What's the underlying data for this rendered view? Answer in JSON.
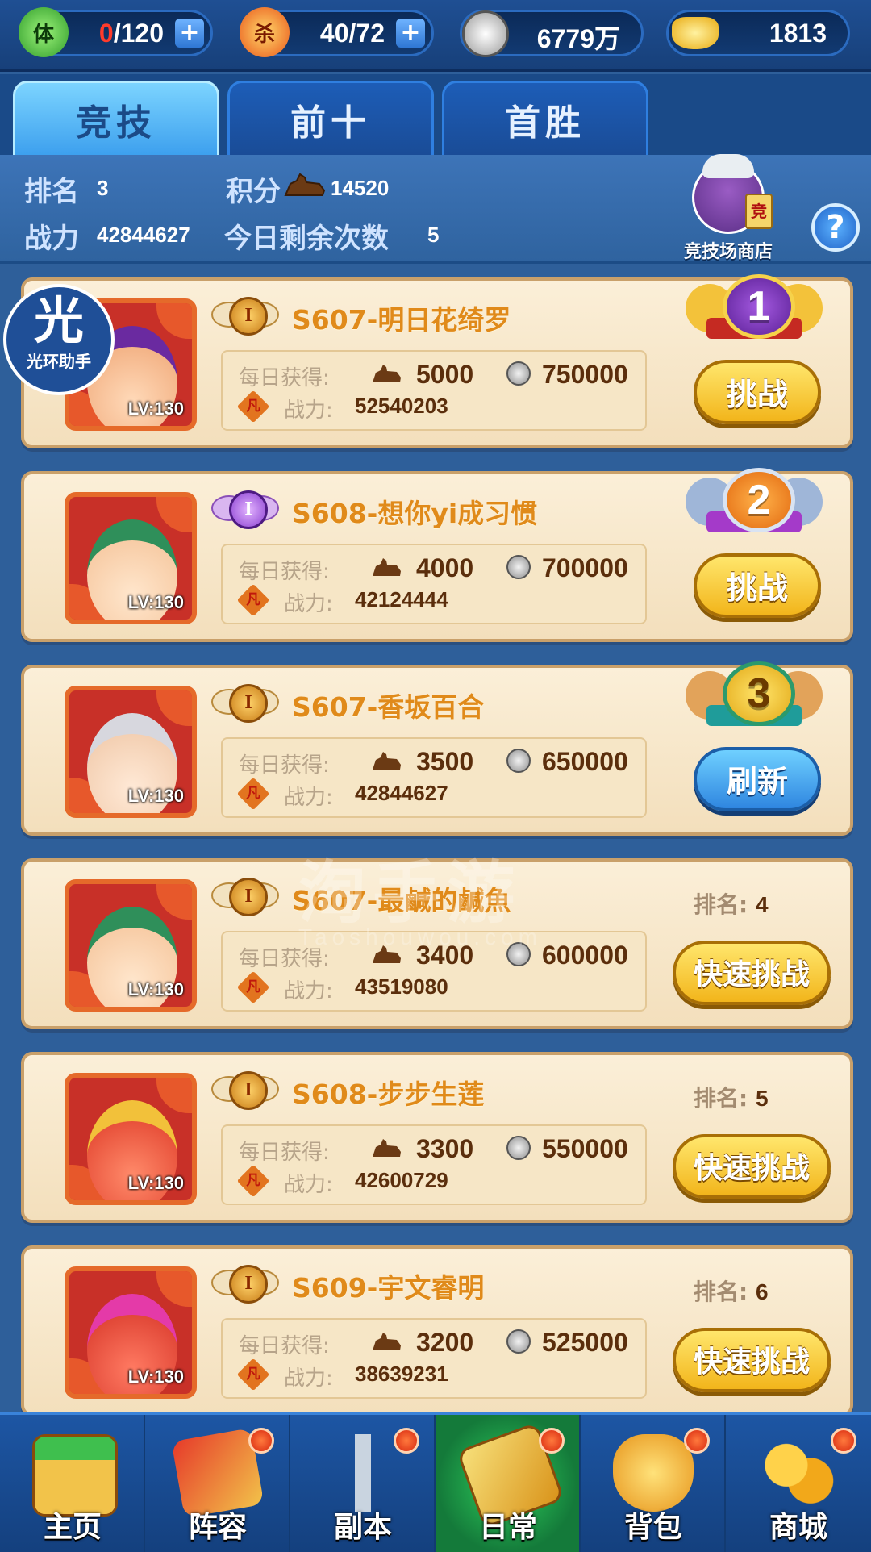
{
  "resources": {
    "stamina": {
      "icon_text": "体",
      "current": "0",
      "max": "/120",
      "icon": "stamina-leaf-icon"
    },
    "kill": {
      "icon_text": "杀",
      "value": "40/72",
      "icon": "kill-flame-icon"
    },
    "silver": {
      "value": "6779万",
      "icon": "silver-coin-icon"
    },
    "gold": {
      "value": "1813",
      "icon": "gold-ingot-icon"
    },
    "plus": "+"
  },
  "tabs": [
    {
      "label": "竞技",
      "active": true
    },
    {
      "label": "前十",
      "active": false
    },
    {
      "label": "首胜",
      "active": false
    }
  ],
  "player": {
    "rank_label": "排名",
    "rank_value": "3",
    "score_label": "积分",
    "score_value": "14520",
    "power_label": "战力",
    "power_value": "42844627",
    "remaining_label": "今日剩余次数",
    "remaining_value": "5"
  },
  "shop": {
    "label": "竞技场商店",
    "tag": "竞"
  },
  "help": "?",
  "helper": {
    "big": "光",
    "small": "光环助手"
  },
  "watermark": {
    "main": "淘手游",
    "sub": "Taoshouwou.com"
  },
  "card_labels": {
    "daily": "每日获得:",
    "power": "战力:",
    "power_icon_text": "凡",
    "rank": "排名:"
  },
  "opponents": [
    {
      "name": "S607-明日花绮罗",
      "level": "LV:130",
      "badge": "I",
      "score": "5000",
      "silver": "750000",
      "power": "52540203",
      "medal": "1",
      "action": "挑战",
      "action_style": "gold"
    },
    {
      "name": "S608-想你yi成习惯",
      "level": "LV:130",
      "badge": "I",
      "score": "4000",
      "silver": "700000",
      "power": "42124444",
      "medal": "2",
      "action": "挑战",
      "action_style": "gold"
    },
    {
      "name": "S607-香坂百合",
      "level": "LV:130",
      "badge": "I",
      "score": "3500",
      "silver": "650000",
      "power": "42844627",
      "medal": "3",
      "action": "刷新",
      "action_style": "blue"
    },
    {
      "name": "S607-最鹹的鹹魚",
      "level": "LV:130",
      "badge": "I",
      "score": "3400",
      "silver": "600000",
      "power": "43519080",
      "rank": "4",
      "action": "快速挑战",
      "action_style": "gold"
    },
    {
      "name": "S608-步步生莲",
      "level": "LV:130",
      "badge": "I",
      "score": "3300",
      "silver": "550000",
      "power": "42600729",
      "rank": "5",
      "action": "快速挑战",
      "action_style": "gold"
    },
    {
      "name": "S609-宇文睿明",
      "level": "LV:130",
      "badge": "I",
      "score": "3200",
      "silver": "525000",
      "power": "38639231",
      "rank": "6",
      "action": "快速挑战",
      "action_style": "gold"
    }
  ],
  "nav": [
    {
      "label": "主页",
      "icon": "home-palace-icon"
    },
    {
      "label": "阵容",
      "icon": "lineup-scroll-icon"
    },
    {
      "label": "副本",
      "icon": "dungeon-sword-icon"
    },
    {
      "label": "日常",
      "icon": "daily-scroll-icon",
      "active": true
    },
    {
      "label": "背包",
      "icon": "bag-icon"
    },
    {
      "label": "商城",
      "icon": "shop-coins-icon"
    }
  ],
  "colors": {
    "accent": "#2f7fe0",
    "card": "#f6e6c6",
    "gold_button": "#f2b51b",
    "blue_button": "#2f86e0",
    "name": "#e08a1a"
  }
}
